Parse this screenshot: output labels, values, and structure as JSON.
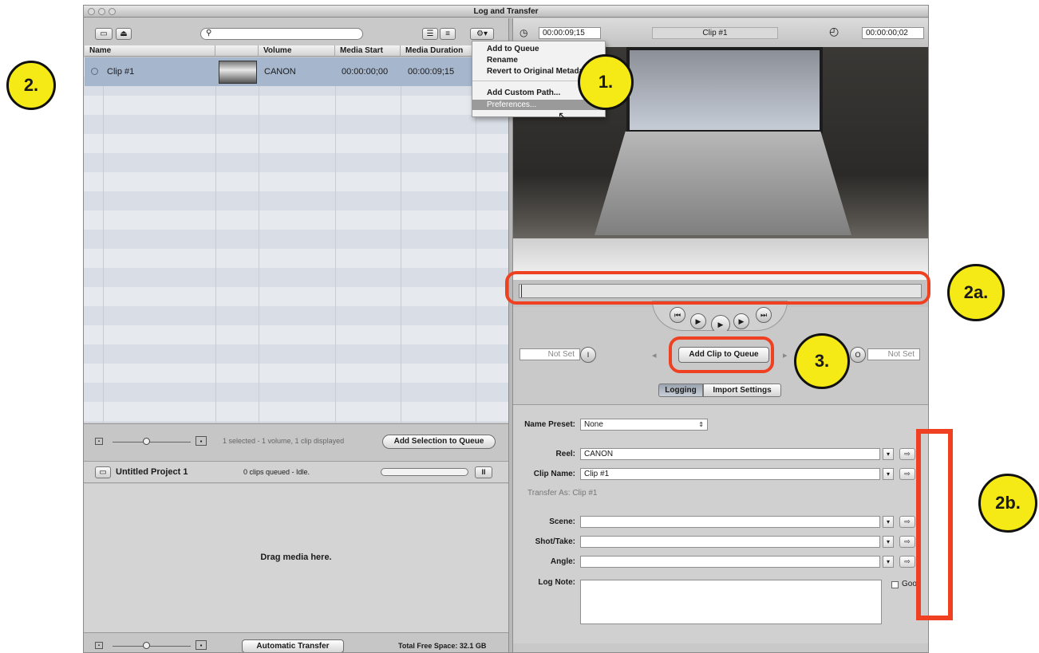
{
  "window": {
    "title": "Log and Transfer"
  },
  "browser": {
    "columns": [
      "Name",
      "Volume",
      "Media Start",
      "Media Duration"
    ],
    "rows": [
      {
        "name": "Clip #1",
        "volume": "CANON",
        "media_start": "00:00:00;00",
        "media_duration": "00:00:09;15"
      }
    ],
    "status": "1 selected - 1 volume, 1 clip displayed",
    "add_selection_button": "Add Selection to Queue"
  },
  "action_menu": {
    "items": [
      "Add to Queue",
      "Rename",
      "Revert to Original Metadata",
      "Add Custom Path...",
      "Preferences..."
    ]
  },
  "queue": {
    "project": "Untitled Project 1",
    "status": "0 clips queued - Idle.",
    "pause": "II",
    "drop_hint": "Drag media here.",
    "auto_transfer_button": "Automatic Transfer",
    "free_space": "Total Free Space: 32.1 GB"
  },
  "viewer": {
    "duration_timecode": "00:00:09;15",
    "clip_title": "Clip #1",
    "current_timecode": "00:00:00;02",
    "in_point": "Not Set",
    "out_point": "Not Set",
    "add_clip_button": "Add Clip to Queue",
    "tabs": [
      "Logging",
      "Import Settings"
    ]
  },
  "logging": {
    "name_preset_label": "Name Preset:",
    "name_preset_value": "None",
    "reel_label": "Reel:",
    "reel_value": "CANON",
    "clip_name_label": "Clip Name:",
    "clip_name_value": "Clip #1",
    "transfer_as": "Transfer As: Clip #1",
    "scene_label": "Scene:",
    "shot_take_label": "Shot/Take:",
    "angle_label": "Angle:",
    "log_note_label": "Log Note:",
    "good_label": "Good"
  },
  "annotations": {
    "badge1": "1.",
    "badge2": "2.",
    "badge2a": "2a.",
    "badge2b": "2b.",
    "badge3": "3."
  },
  "colors": {
    "badge_fill": "#f6ea16",
    "highlight_red": "#ef4022",
    "selection": "#a6b6cc"
  }
}
